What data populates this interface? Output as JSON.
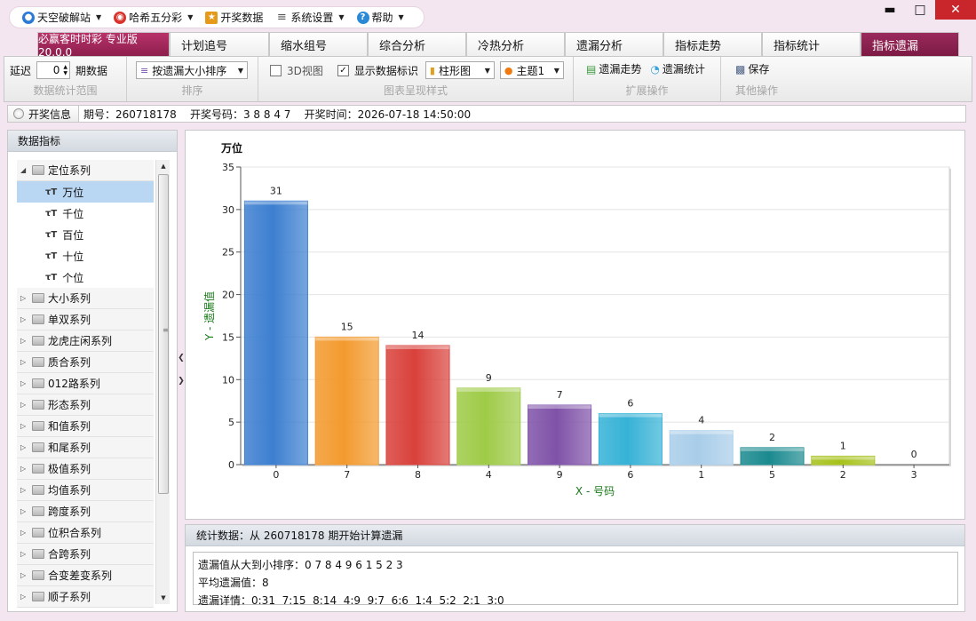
{
  "menu": [
    {
      "label": "天空破解站",
      "icon": "user-icon"
    },
    {
      "label": "哈希五分彩",
      "icon": "lottery-icon"
    },
    {
      "label": "开奖数据",
      "icon": "trophy-icon"
    },
    {
      "label": "系统设置",
      "icon": "settings-icon"
    },
    {
      "label": "帮助",
      "icon": "help-icon"
    }
  ],
  "tabs": [
    "必赢客时时彩 专业版 20.0.0",
    "计划追号",
    "缩水组号",
    "综合分析",
    "冷热分析",
    "遗漏分析",
    "指标走势",
    "指标统计",
    "指标遗漏"
  ],
  "ribbon": {
    "delay_label": "延迟",
    "delay_value": "0",
    "period_label": "期数据",
    "group1_label": "数据统计范围",
    "sort_value": "按遗漏大小排序",
    "group2_label": "排序",
    "view3d_label": "3D视图",
    "show_labels_label": "显示数据标识",
    "chart_type_value": "柱形图",
    "theme_value": "主题1",
    "group3_label": "图表呈现样式",
    "trend_label": "遗漏走势",
    "stats_label": "遗漏统计",
    "group4_label": "扩展操作",
    "save_label": "保存",
    "group5_label": "其他操作"
  },
  "info": {
    "button_label": "开奖信息",
    "text": "期号：260718178    开奖号码：3 8 8 4 7    开奖时间：2026-07-18 14:50:00"
  },
  "left": {
    "header": "数据指标",
    "group_open": "定位系列",
    "leaves": [
      "万位",
      "千位",
      "百位",
      "十位",
      "个位"
    ],
    "groups": [
      "大小系列",
      "单双系列",
      "龙虎庄闲系列",
      "质合系列",
      "012路系列",
      "形态系列",
      "和值系列",
      "和尾系列",
      "极值系列",
      "均值系列",
      "跨度系列",
      "位积合系列",
      "合跨系列",
      "合变差变系列",
      "顺子系列"
    ]
  },
  "chart_data": {
    "type": "bar",
    "title": "万位",
    "xlabel": "X - 号码",
    "ylabel": "Y - 遗漏值",
    "categories": [
      "0",
      "7",
      "8",
      "4",
      "9",
      "6",
      "1",
      "5",
      "2",
      "3"
    ],
    "values": [
      31,
      15,
      14,
      9,
      7,
      6,
      4,
      2,
      1,
      0
    ],
    "colors": [
      "#3d7fd0",
      "#f39a2e",
      "#d9413b",
      "#9ecb47",
      "#7f52a8",
      "#36b2d6",
      "#a9cde9",
      "#1a8a8f",
      "#a6c21a",
      "#cccccc"
    ],
    "ylim": [
      0,
      35
    ],
    "yticks": [
      0,
      5,
      10,
      15,
      20,
      25,
      30,
      35
    ],
    "grid": true,
    "data_labels": true
  },
  "stats": {
    "header": "统计数据：从 260718178 期开始计算遗漏",
    "line1": "遗漏值从大到小排序：0 7 8 4 9 6 1 5 2 3",
    "line2": "平均遗漏值：8",
    "line3": "遗漏详情：0:31  7:15  8:14  4:9  9:7  6:6  1:4  5:2  2:1  3:0"
  }
}
